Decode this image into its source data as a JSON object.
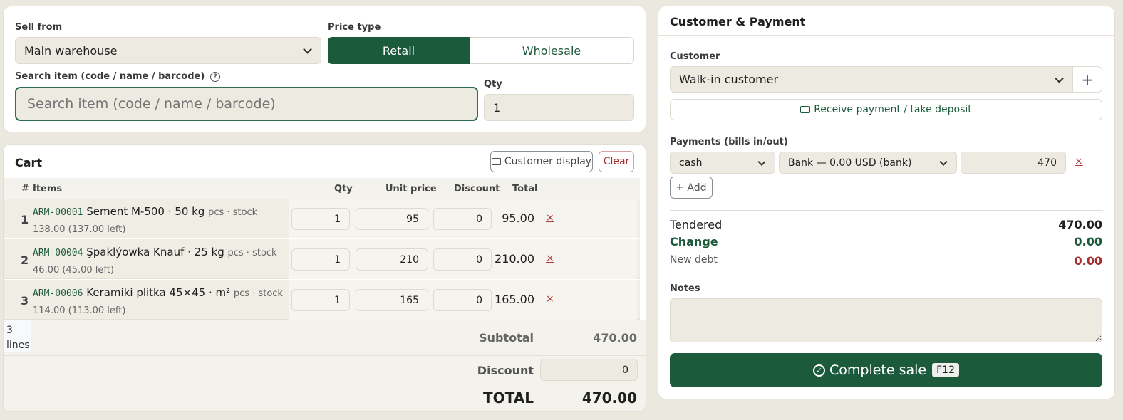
{
  "top": {
    "sell_from_label": "Sell from",
    "sell_from_value": "Main warehouse",
    "price_type_label": "Price type",
    "price_retail": "Retail",
    "price_wholesale": "Wholesale",
    "search_label": "Search item (code / name / barcode)",
    "search_placeholder": "Search item (code / name / barcode)",
    "qty_label": "Qty",
    "qty_value": "1"
  },
  "cart": {
    "title": "Cart",
    "customer_display": "Customer display",
    "clear": "Clear",
    "columns": {
      "num": "#",
      "items": "Items",
      "qty": "Qty",
      "unit_price": "Unit price",
      "discount": "Discount",
      "total": "Total"
    },
    "rows": [
      {
        "n": "1",
        "code": "ARM-00001",
        "name": "Sement M-500 · 50 kg",
        "unit": "pcs · stock",
        "stock": "138.00 (137.00 left)",
        "qty": "1",
        "price": "95",
        "discount": "0",
        "total": "95.00"
      },
      {
        "n": "2",
        "code": "ARM-00004",
        "name": "Şpaklýowka Knauf · 25 kg",
        "unit": "pcs · stock",
        "stock": "46.00 (45.00 left)",
        "qty": "1",
        "price": "210",
        "discount": "0",
        "total": "210.00"
      },
      {
        "n": "3",
        "code": "ARM-00006",
        "name": "Keramiki plitka 45×45 · m²",
        "unit": "pcs · stock",
        "stock": "114.00 (113.00 left)",
        "qty": "1",
        "price": "165",
        "discount": "0",
        "total": "165.00"
      }
    ],
    "remove": "×",
    "lines_count": "3",
    "lines_word": "lines",
    "subtotal_label": "Subtotal",
    "subtotal_value": "470.00",
    "discount_label": "Discount",
    "discount_value": "0",
    "total_label": "TOTAL",
    "total_value": "470.00"
  },
  "payment": {
    "title": "Customer & Payment",
    "customer_label": "Customer",
    "customer_value": "Walk-in customer",
    "add_customer": "+",
    "receive_payment": "Receive payment / take deposit",
    "payments_label": "Payments (bills in/out)",
    "method": "cash",
    "account": "Bank — 0.00 USD (bank)",
    "amount": "470",
    "remove": "×",
    "add_label": "Add",
    "tendered_label": "Tendered",
    "tendered_value": "470.00",
    "change_label": "Change",
    "change_value": "0.00",
    "debt_label": "New debt",
    "debt_value": "0.00",
    "notes_label": "Notes",
    "complete": "Complete sale",
    "complete_key": "F12"
  },
  "colors": {
    "accent": "#1c5a3c",
    "danger": "#a32d2d",
    "field_bg": "#edeae1",
    "page_bg": "#ebe8df"
  }
}
